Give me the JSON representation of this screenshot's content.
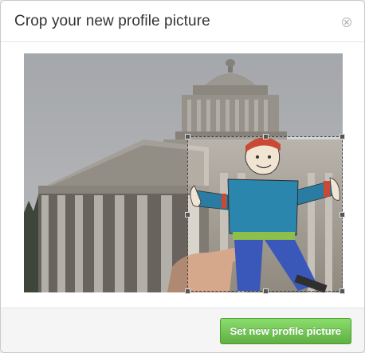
{
  "dialog": {
    "title": "Crop your new profile picture",
    "close_icon": "close-circle-icon"
  },
  "image": {
    "alt": "Photo of a domed capitol building with a hand-drawn paper figure held in front"
  },
  "footer": {
    "submit_label": "Set new profile picture"
  },
  "colors": {
    "button_green": "#60b044",
    "crop_outline": "#444444"
  }
}
